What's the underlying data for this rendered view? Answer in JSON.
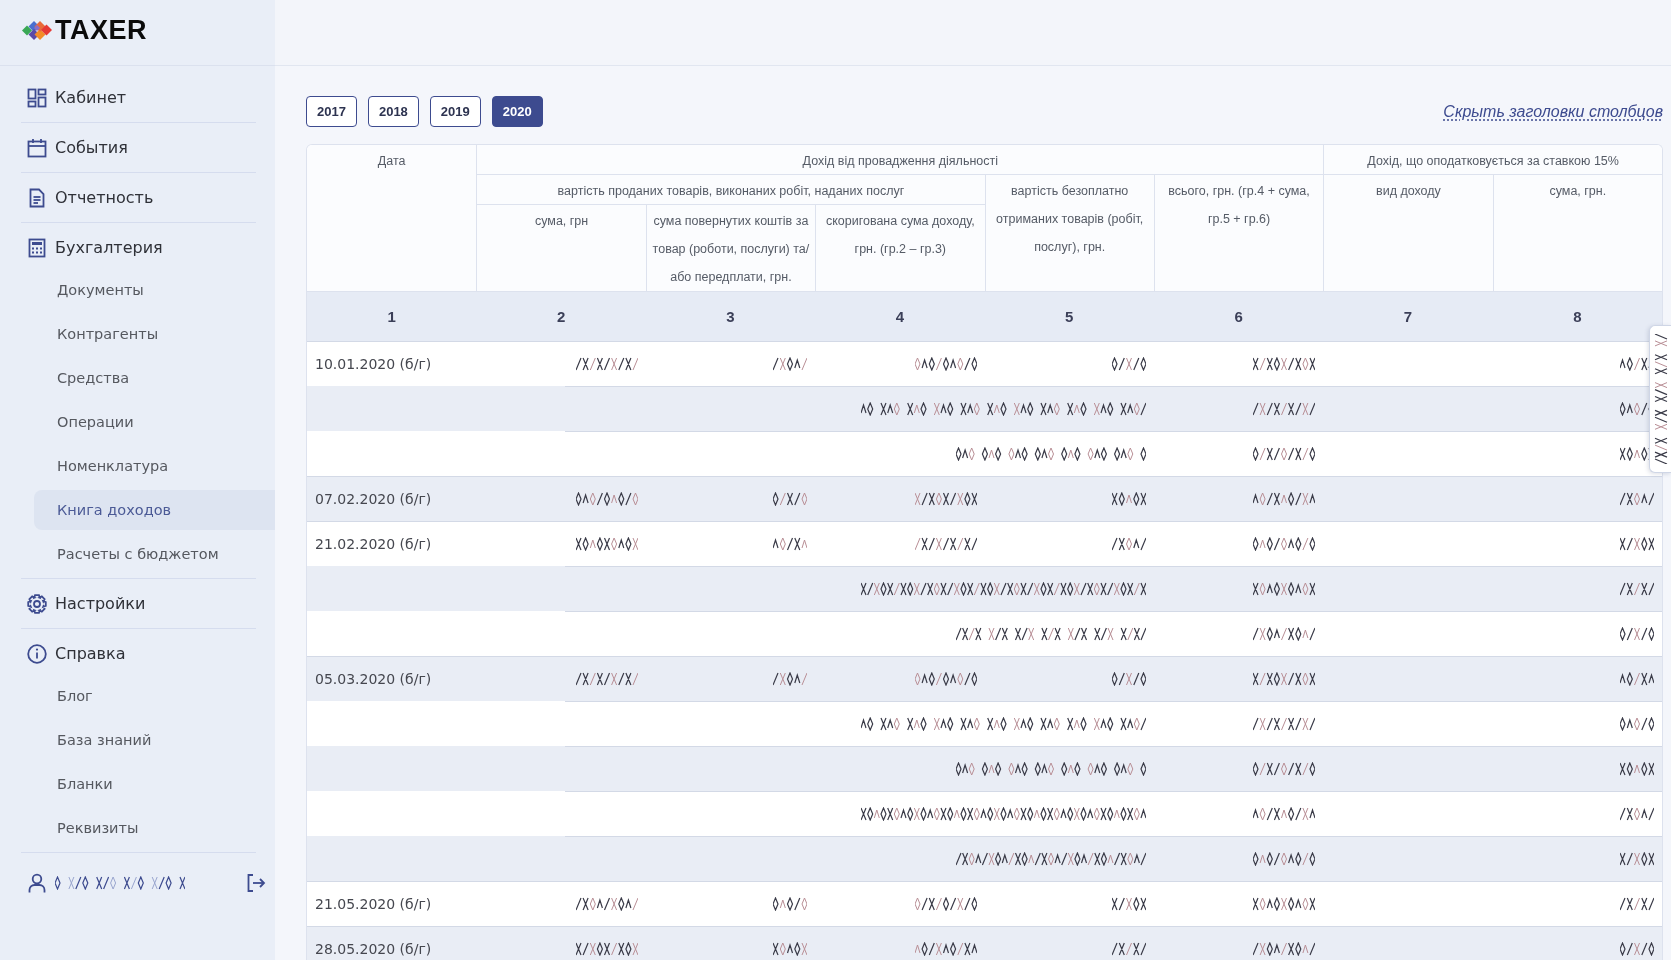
{
  "sidebar": {
    "brand": "TAXER",
    "sections": [
      {
        "label": "Кабинет",
        "selected": false
      },
      {
        "label": "События",
        "selected": false
      },
      {
        "label": "Отчетность",
        "selected": false
      },
      {
        "label": "Бухгалтерия",
        "selected": false,
        "children": [
          {
            "label": "Документы",
            "selected": false
          },
          {
            "label": "Контрагенты",
            "selected": false
          },
          {
            "label": "Средства",
            "selected": false
          },
          {
            "label": "Операции",
            "selected": false
          },
          {
            "label": "Номенклатура",
            "selected": false
          },
          {
            "label": "Книга доходов",
            "selected": true
          },
          {
            "label": "Расчеты с бюджетом",
            "selected": false
          }
        ]
      },
      {
        "label": "Настройки",
        "selected": false
      },
      {
        "label": "Справка",
        "selected": false,
        "children": [
          {
            "label": "Блог",
            "selected": false
          },
          {
            "label": "База знаний",
            "selected": false
          },
          {
            "label": "Бланки",
            "selected": false
          },
          {
            "label": "Реквизиты",
            "selected": false
          }
        ]
      }
    ],
    "user": {
      "name": {
        "kind": "label"
      }
    }
  },
  "years": [
    {
      "label": "2017",
      "selected": false
    },
    {
      "label": "2018",
      "selected": false
    },
    {
      "label": "2019",
      "selected": false
    },
    {
      "label": "2020",
      "selected": true
    }
  ],
  "toggle_link": "Скрыть заголовки столбцов",
  "table": {
    "columns": [
      {
        "label": "Дата"
      },
      {
        "label": "Дохід від провадження діяльності",
        "children": [
          {
            "label": "вартість проданих товарів, виконаних робіт, наданих послуг",
            "children": [
              {
                "label": "сума, грн"
              },
              {
                "label": "сума повернутих коштів за товар (роботи, послуги) та/або передплати, грн."
              },
              {
                "label": "скоригована сума доходу, грн. (гр.2 – гр.3)"
              }
            ]
          },
          {
            "label": "вартість безоплатно отриманих товарів (робіт, послуг), грн."
          },
          {
            "label": "всього, грн. (гр.4 + сума, гр.5 + гр.6)"
          }
        ]
      },
      {
        "label": "Дохід, що оподатковується за ставкою 15%",
        "children": [
          {
            "label": "вид доходу"
          },
          {
            "label": "сума, грн."
          }
        ]
      }
    ],
    "column_numbers": [
      "1",
      "2",
      "3",
      "4",
      "5",
      "6",
      "7",
      "8"
    ],
    "rows": [
      {
        "kind": "entry",
        "date": "10.01.2020 (б/г)",
        "column_2": {
          "kind": "word"
        },
        "column_3": {
          "kind": "mark"
        },
        "column_4": {
          "kind": "word"
        },
        "column_5": {
          "kind": "mark"
        },
        "column_6": {
          "kind": "word"
        },
        "column_8": {
          "kind": "mark"
        }
      },
      {
        "kind": "detail",
        "column_5": {
          "kind": "sentence"
        },
        "column_6": {
          "kind": "word"
        },
        "column_8": {
          "kind": "mark"
        }
      },
      {
        "kind": "detail",
        "column_5": {
          "kind": "phrase"
        },
        "column_6": {
          "kind": "word"
        },
        "column_8": {
          "kind": "mark"
        }
      },
      {
        "kind": "entry",
        "date": "07.02.2020 (б/г)",
        "column_2": {
          "kind": "word"
        },
        "column_3": {
          "kind": "mark"
        },
        "column_4": {
          "kind": "word"
        },
        "column_5": {
          "kind": "mark"
        },
        "column_6": {
          "kind": "word"
        },
        "column_8": {
          "kind": "mark"
        }
      },
      {
        "kind": "entry",
        "date": "21.02.2020 (б/г)",
        "column_2": {
          "kind": "word"
        },
        "column_3": {
          "kind": "mark"
        },
        "column_4": {
          "kind": "word"
        },
        "column_5": {
          "kind": "mark"
        },
        "column_6": {
          "kind": "word"
        },
        "column_8": {
          "kind": "mark"
        }
      },
      {
        "kind": "detail",
        "column_5": {
          "kind": "sentence"
        },
        "column_6": {
          "kind": "word"
        },
        "column_8": {
          "kind": "mark"
        }
      },
      {
        "kind": "detail",
        "column_5": {
          "kind": "phrase"
        },
        "column_6": {
          "kind": "word"
        },
        "column_8": {
          "kind": "mark"
        }
      },
      {
        "kind": "entry",
        "date": "05.03.2020 (б/г)",
        "column_2": {
          "kind": "word"
        },
        "column_3": {
          "kind": "mark"
        },
        "column_4": {
          "kind": "word"
        },
        "column_5": {
          "kind": "mark"
        },
        "column_6": {
          "kind": "word"
        },
        "column_8": {
          "kind": "mark"
        }
      },
      {
        "kind": "detail",
        "column_5": {
          "kind": "sentence"
        },
        "column_6": {
          "kind": "word"
        },
        "column_8": {
          "kind": "mark"
        }
      },
      {
        "kind": "detail",
        "column_5": {
          "kind": "phrase"
        },
        "column_6": {
          "kind": "word"
        },
        "column_8": {
          "kind": "mark"
        }
      },
      {
        "kind": "detail",
        "column_5": {
          "kind": "sentence"
        },
        "column_6": {
          "kind": "word"
        },
        "column_8": {
          "kind": "mark"
        }
      },
      {
        "kind": "detail",
        "column_5": {
          "kind": "phrase"
        },
        "column_6": {
          "kind": "word"
        },
        "column_8": {
          "kind": "mark"
        }
      },
      {
        "kind": "entry",
        "date": "21.05.2020 (б/г)",
        "column_2": {
          "kind": "word"
        },
        "column_3": {
          "kind": "mark"
        },
        "column_4": {
          "kind": "word"
        },
        "column_5": {
          "kind": "mark"
        },
        "column_6": {
          "kind": "word"
        },
        "column_8": {
          "kind": "mark"
        }
      },
      {
        "kind": "entry",
        "date": "28.05.2020 (б/г)",
        "column_2": {
          "kind": "word"
        },
        "column_3": {
          "kind": "mark"
        },
        "column_4": {
          "kind": "word"
        },
        "column_5": {
          "kind": "mark"
        },
        "column_6": {
          "kind": "word"
        },
        "column_8": {
          "kind": "mark"
        }
      }
    ]
  },
  "side_tab": {
    "label": {
      "kind": "label"
    }
  }
}
